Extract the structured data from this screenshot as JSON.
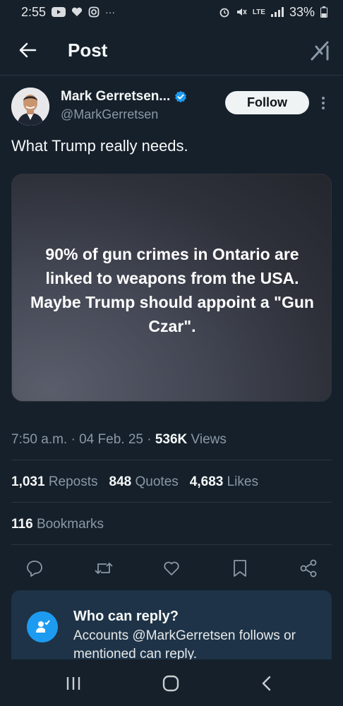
{
  "status_bar": {
    "time": "2:55",
    "network": "LTE",
    "battery": "33%",
    "left_icons": [
      "youtube-icon",
      "heart-icon",
      "instagram-icon",
      "more-dots-icon"
    ],
    "right_icons": [
      "alarm-icon",
      "mute-icon",
      "signal-icon",
      "battery-icon"
    ]
  },
  "header": {
    "title": "Post",
    "back_icon": "arrow-left-icon",
    "grok_icon": "grok-icon"
  },
  "author": {
    "name": "Mark Gerretsen...",
    "handle": "@MarkGerretsen",
    "verified": true,
    "follow_label": "Follow"
  },
  "post": {
    "text": "What Trump really needs.",
    "image_text": "90% of gun crimes in Ontario are linked to weapons from the USA. Maybe Trump should appoint a \"Gun Czar\"."
  },
  "meta": {
    "time": "7:50 a.m.",
    "date": "04 Feb. 25",
    "views_count": "536K",
    "views_label": "Views"
  },
  "stats": {
    "reposts_count": "1,031",
    "reposts_label": "Reposts",
    "quotes_count": "848",
    "quotes_label": "Quotes",
    "likes_count": "4,683",
    "likes_label": "Likes",
    "bookmarks_count": "116",
    "bookmarks_label": "Bookmarks"
  },
  "actions": [
    "reply-icon",
    "repost-icon",
    "like-icon",
    "bookmark-icon",
    "share-icon"
  ],
  "who_can_reply": {
    "title": "Who can reply?",
    "text": "Accounts @MarkGerretsen follows or mentioned can reply."
  },
  "colors": {
    "background": "#15202b",
    "accent": "#1d9bf0",
    "secondary_text": "#8b98a5"
  }
}
